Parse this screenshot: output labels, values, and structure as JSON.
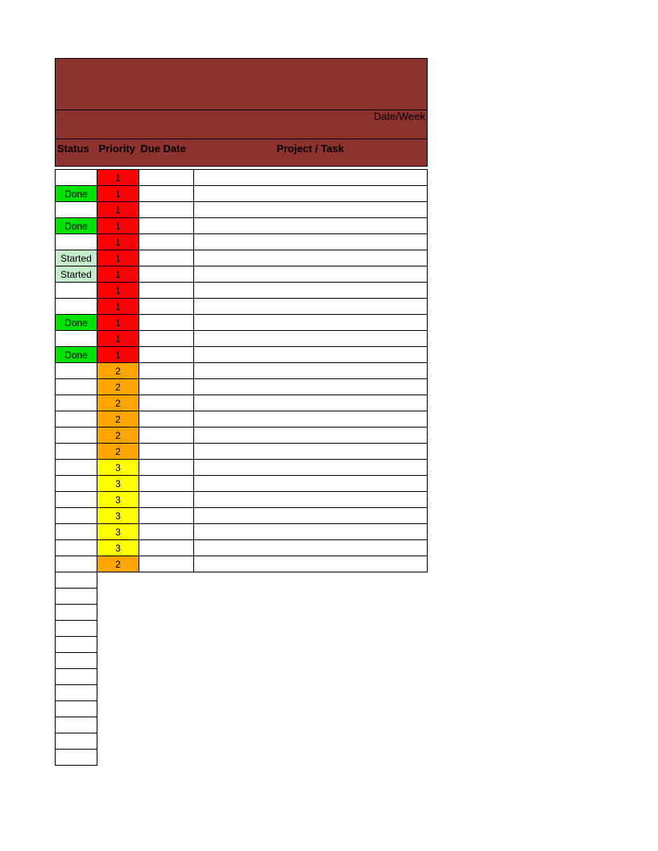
{
  "colors": {
    "header_bg": "#8e3230",
    "priority_1": "#fe0000",
    "priority_2": "#ffa500",
    "priority_3": "#ffff00",
    "status_done": "#00e300",
    "status_started": "#c5edcb"
  },
  "header": {
    "date_week_label": "Date/Week",
    "columns": {
      "status": "Status",
      "priority": "Priority",
      "due_date": "Due Date",
      "project_task": "Project / Task"
    }
  },
  "rows": [
    {
      "status": "",
      "priority": "1",
      "due": "",
      "project": ""
    },
    {
      "status": "Done",
      "priority": "1",
      "due": "",
      "project": ""
    },
    {
      "status": "",
      "priority": "1",
      "due": "",
      "project": ""
    },
    {
      "status": "Done",
      "priority": "1",
      "due": "",
      "project": ""
    },
    {
      "status": "",
      "priority": "1",
      "due": "",
      "project": ""
    },
    {
      "status": "Started",
      "priority": "1",
      "due": "",
      "project": ""
    },
    {
      "status": "Started",
      "priority": "1",
      "due": "",
      "project": ""
    },
    {
      "status": "",
      "priority": "1",
      "due": "",
      "project": ""
    },
    {
      "status": "",
      "priority": "1",
      "due": "",
      "project": ""
    },
    {
      "status": "Done",
      "priority": "1",
      "due": "",
      "project": ""
    },
    {
      "status": "",
      "priority": "1",
      "due": "",
      "project": ""
    },
    {
      "status": "Done",
      "priority": "1",
      "due": "",
      "project": ""
    },
    {
      "status": "",
      "priority": "2",
      "due": "",
      "project": ""
    },
    {
      "status": "",
      "priority": "2",
      "due": "",
      "project": ""
    },
    {
      "status": "",
      "priority": "2",
      "due": "",
      "project": ""
    },
    {
      "status": "",
      "priority": "2",
      "due": "",
      "project": ""
    },
    {
      "status": "",
      "priority": "2",
      "due": "",
      "project": ""
    },
    {
      "status": "",
      "priority": "2",
      "due": "",
      "project": ""
    },
    {
      "status": "",
      "priority": "3",
      "due": "",
      "project": ""
    },
    {
      "status": "",
      "priority": "3",
      "due": "",
      "project": ""
    },
    {
      "status": "",
      "priority": "3",
      "due": "",
      "project": ""
    },
    {
      "status": "",
      "priority": "3",
      "due": "",
      "project": ""
    },
    {
      "status": "",
      "priority": "3",
      "due": "",
      "project": ""
    },
    {
      "status": "",
      "priority": "3",
      "due": "",
      "project": ""
    },
    {
      "status": "",
      "priority": "2",
      "due": "",
      "project": ""
    }
  ],
  "tail_rows": 12
}
